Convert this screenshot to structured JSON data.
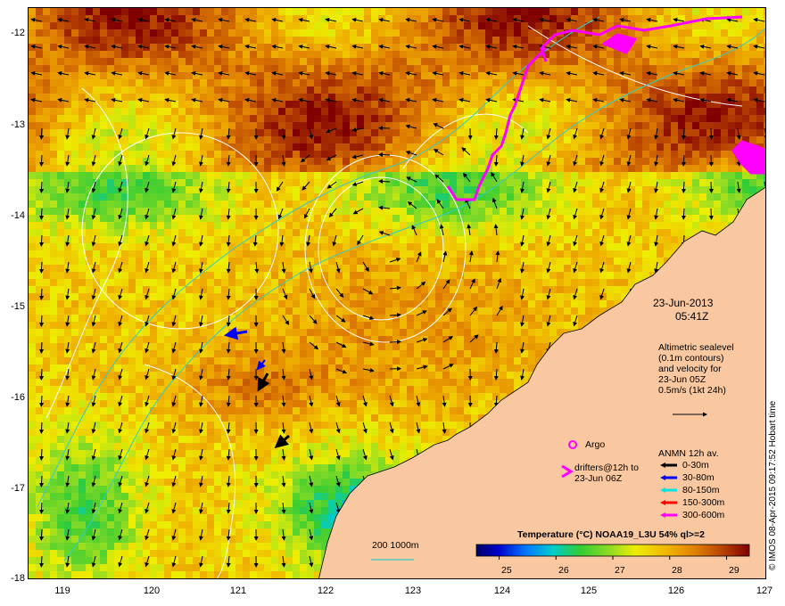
{
  "map": {
    "date": "23-Jun-2013",
    "time": "05:41Z",
    "credit": "© IMOS 08-Apr-2015 09:17:52 Hobart time",
    "lat_ticks": [
      "-12",
      "-13",
      "-14",
      "-15",
      "-16",
      "-17",
      "-18"
    ],
    "lon_ticks": [
      "119",
      "120",
      "121",
      "122",
      "123",
      "124",
      "125",
      "126",
      "127"
    ],
    "lat_range": [
      -18,
      -11.85
    ],
    "lon_range": [
      118.6,
      127
    ],
    "altimetry_text": [
      "Altimetric sealevel",
      "(0.1m contours)",
      "and velocity for",
      "23-Jun 05Z",
      "0.5m/s (1kt 24h)"
    ],
    "argo_label": "Argo",
    "drifters_label": [
      "drifters@12h to",
      "23-Jun 06Z"
    ],
    "anmn_title": "ANMN 12h av.",
    "anmn_items": [
      {
        "label": "0-30m",
        "color": "#000000"
      },
      {
        "label": "30-80m",
        "color": "#0000ff"
      },
      {
        "label": "80-150m",
        "color": "#00e5e5"
      },
      {
        "label": "150-300m",
        "color": "#ff0000"
      },
      {
        "label": "300-600m",
        "color": "#ff00ff"
      }
    ],
    "isobath_label": "200  1000m",
    "colorbar_title": "Temperature (°C) NOAA19_L3U 54% ql>=2",
    "colorbar_ticks": [
      "25",
      "26",
      "27",
      "28",
      "29"
    ],
    "colorbar_range": [
      24.6,
      29.4
    ],
    "colors": {
      "land": "#f9c8a0",
      "accent_magenta": "#ff00ff",
      "isobath": "#33cccc",
      "contour": "#ffffff"
    }
  }
}
